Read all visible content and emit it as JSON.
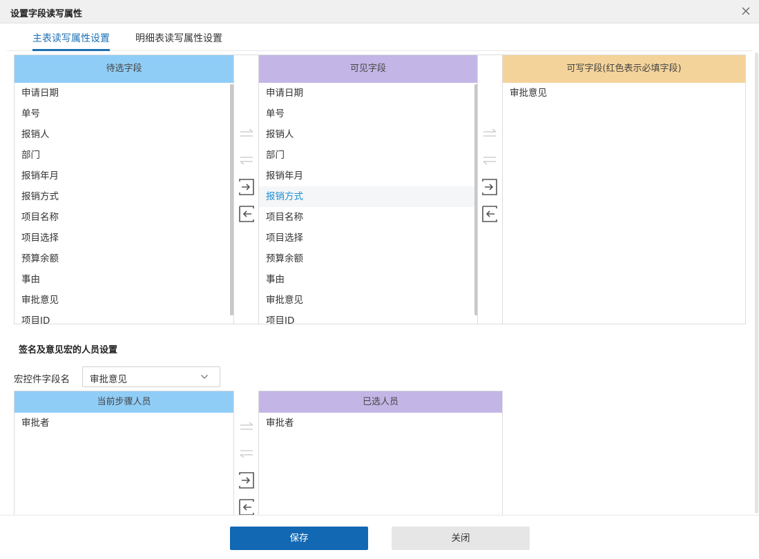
{
  "dialog": {
    "title": "设置字段读写属性"
  },
  "tabs": [
    {
      "label": "主表读写属性设置",
      "active": true
    },
    {
      "label": "明细表读写属性设置",
      "active": false
    }
  ],
  "pending": {
    "header": "待选字段",
    "items": [
      "申请日期",
      "单号",
      "报销人",
      "部门",
      "报销年月",
      "报销方式",
      "项目名称",
      "项目选择",
      "预算余额",
      "事由",
      "审批意见",
      "项目ID"
    ]
  },
  "visible": {
    "header": "可见字段",
    "items": [
      "申请日期",
      "单号",
      "报销人",
      "部门",
      "报销年月",
      "报销方式",
      "项目名称",
      "项目选择",
      "预算余额",
      "事由",
      "审批意见",
      "项目ID"
    ],
    "selected": "报销方式"
  },
  "writable": {
    "header": "可写字段(红色表示必填字段)",
    "items": [
      "审批意见"
    ]
  },
  "signature": {
    "section_title": "签名及意见宏的人员设置",
    "macro_label": "宏控件字段名",
    "macro_value": "审批意见",
    "current": {
      "header": "当前步骤人员",
      "items": [
        "审批者"
      ]
    },
    "chosen": {
      "header": "已选人员",
      "items": [
        "审批者"
      ]
    }
  },
  "footer": {
    "save_label": "保存",
    "close_label": "关闭"
  },
  "colors": {
    "accent": "#1b6fb3",
    "header_blue": "#90cdf6",
    "header_purple": "#c3b6e6",
    "header_orange": "#f4d39a",
    "primary_button": "#1268b3",
    "selected_text": "#1b8fd6"
  },
  "icons": {
    "close": "close-icon",
    "move_all_right": "double-arrow-right-icon",
    "move_all_left": "double-arrow-left-icon",
    "move_right": "move-right-icon",
    "move_left": "move-left-icon",
    "dropdown": "chevron-down-icon"
  }
}
